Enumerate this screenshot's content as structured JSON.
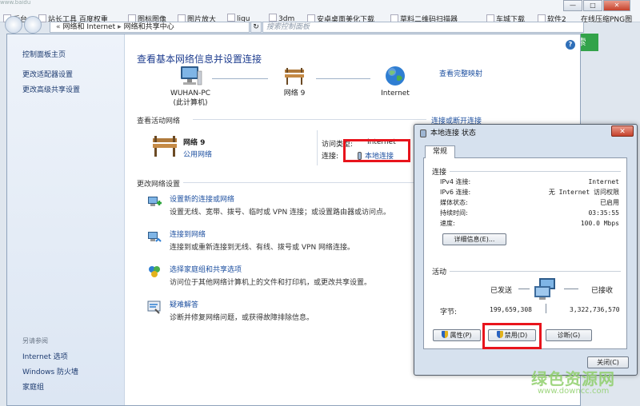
{
  "browser": {
    "faded_top": "www.baidu",
    "bookmarks": [
      "后台",
      "站长工具 百度权重",
      "图标图像",
      "图片放大",
      "liqu",
      "3dm",
      "安卓桌面美化下载",
      "草料二维码扫描器",
      "车城下载",
      "软件2",
      "在线压缩PNG图"
    ],
    "window_buttons": [
      "—",
      "□",
      "✕"
    ],
    "side_button": "索"
  },
  "address_bar": {
    "crumbs": [
      "网络和 Internet",
      "网络和共享中心"
    ],
    "search_placeholder": "搜索控制面板"
  },
  "left_pane": {
    "links": [
      "控制面板主页",
      "更改适配器设置",
      "更改高级共享设置"
    ],
    "see_also": "另请参阅",
    "see_links": [
      "Internet 选项",
      "Windows 防火墙",
      "家庭组"
    ]
  },
  "main": {
    "title": "查看基本网络信息并设置连接",
    "full_map": "查看完整映射",
    "nodes": [
      {
        "label": "WUHAN-PC",
        "sub": "(此计算机)"
      },
      {
        "label": "网络  9",
        "sub": ""
      },
      {
        "label": "Internet",
        "sub": ""
      }
    ],
    "active_title": "查看活动网络",
    "connect_link": "连接或断开连接",
    "network_name": "网络  9",
    "network_type": "公用网络",
    "access_type_label": "访问类型:",
    "access_type_value": "Internet",
    "connection_label": "连接:",
    "connection_value": "本地连接",
    "change_title": "更改网络设置",
    "tasks": [
      {
        "link": "设置新的连接或网络",
        "desc": "设置无线、宽带、拨号、临时或 VPN 连接；或设置路由器或访问点。"
      },
      {
        "link": "连接到网络",
        "desc": "连接到或重新连接到无线、有线、拨号或 VPN 网络连接。"
      },
      {
        "link": "选择家庭组和共享选项",
        "desc": "访问位于其他网络计算机上的文件和打印机，或更改共享设置。"
      },
      {
        "link": "疑难解答",
        "desc": "诊断并修复网络问题，或获得故障排除信息。"
      }
    ]
  },
  "dialog": {
    "title": "本地连接 状态",
    "close": "✕",
    "tab": "常规",
    "connection_group": "连接",
    "rows": [
      {
        "key": "IPv4 连接:",
        "value": "Internet"
      },
      {
        "key": "IPv6 连接:",
        "value": "无 Internet 访问权限"
      },
      {
        "key": "媒体状态:",
        "value": "已启用"
      },
      {
        "key": "持续时间:",
        "value": "03:35:55"
      },
      {
        "key": "速度:",
        "value": "100.0 Mbps"
      }
    ],
    "details_button": "详细信息(E)...",
    "activity_group": "活动",
    "sent_label": "已发送",
    "received_label": "已接收",
    "bytes_label": "字节:",
    "sent_bytes": "199,659,308",
    "received_bytes": "3,322,736,570",
    "properties_button": "属性(P)",
    "disable_button": "禁用(D)",
    "diagnose_button": "诊断(G)",
    "close_button": "关闭(C)"
  },
  "watermark": {
    "cn": "绿色资源网",
    "url": "www.downcc.com"
  },
  "colors": {
    "link": "#1e50a0",
    "title": "#1e3d8f",
    "highlight": "#e8141c",
    "watermark": "#8fcf6b"
  }
}
